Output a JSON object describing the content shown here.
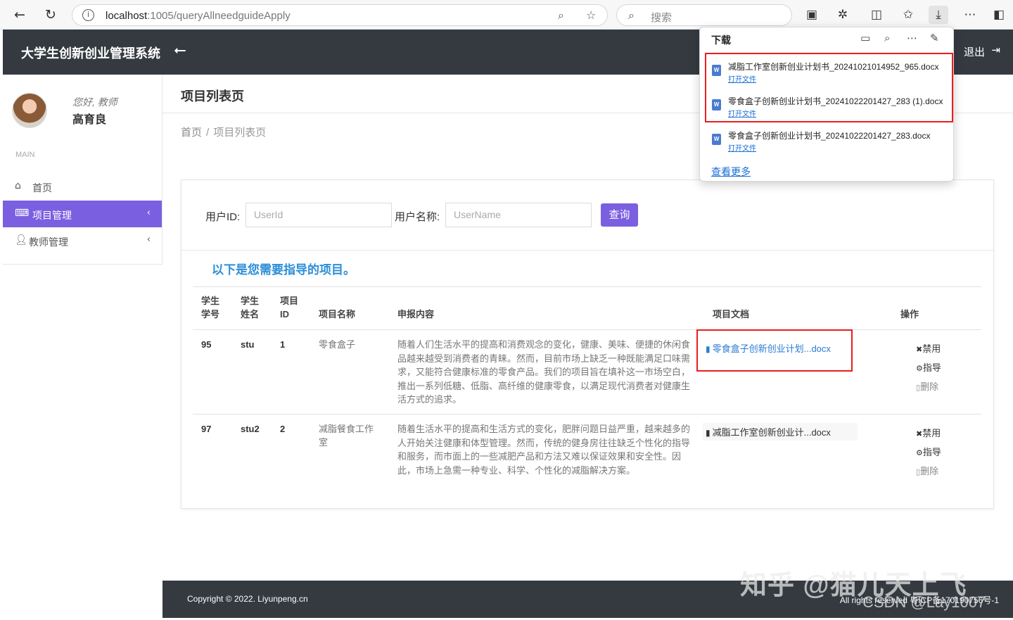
{
  "browser": {
    "url_host": "localhost",
    "url_path": ":1005/queryAllneedguideApply",
    "search_placeholder": "搜索"
  },
  "header": {
    "app_title": "大学生创新创业管理系统",
    "logout_label": "退出"
  },
  "sidebar": {
    "greeting": "您好, 教师",
    "user_name": "高育良",
    "menu_label": "MAIN",
    "items": [
      {
        "label": "首页",
        "icon": "home-icon"
      },
      {
        "label": "项目管理",
        "icon": "keyboard-icon",
        "active": true
      },
      {
        "label": "教师管理",
        "icon": "user-icon"
      }
    ]
  },
  "page": {
    "title": "项目列表页",
    "breadcrumb_home": "首页",
    "breadcrumb_sep": "/",
    "breadcrumb_current": "项目列表页"
  },
  "form": {
    "userid_label": "用户ID:",
    "userid_placeholder": "UserId",
    "username_label": "用户名称:",
    "username_placeholder": "UserName",
    "query_label": "查询"
  },
  "notice": "以下是您需要指导的项目。",
  "table": {
    "headers": {
      "stu_id_1": "学生",
      "stu_id_2": "学号",
      "stu_name_1": "学生",
      "stu_name_2": "姓名",
      "proj_id_1": "项目",
      "proj_id_2": "ID",
      "proj_name": "项目名称",
      "content": "申报内容",
      "doc": "项目文档",
      "ops": "操作"
    },
    "rows": [
      {
        "stu_id": "95",
        "stu_name": "stu",
        "proj_id": "1",
        "proj_name": "零食盒子",
        "content": "随着人们生活水平的提高和消费观念的变化，健康、美味、便捷的休闲食品越来越受到消费者的青睐。然而，目前市场上缺乏一种既能满足口味需求，又能符合健康标准的零食产品。我们的项目旨在填补这一市场空白，推出一系列低糖、低脂、高纤维的健康零食，以满足现代消费者对健康生活方式的追求。",
        "doc": "零食盒子创新创业计划...docx",
        "op_disable": "禁用",
        "op_guide": "指导",
        "op_delete": "删除"
      },
      {
        "stu_id": "97",
        "stu_name": "stu2",
        "proj_id": "2",
        "proj_name": "减脂餐食工作室",
        "content": "随着生活水平的提高和生活方式的变化，肥胖问题日益严重，越来越多的人开始关注健康和体型管理。然而，传统的健身房往往缺乏个性化的指导和服务，而市面上的一些减肥产品和方法又难以保证效果和安全性。因此，市场上急需一种专业、科学、个性化的减脂解决方案。",
        "doc": "减脂工作室创新创业计...docx",
        "op_disable": "禁用",
        "op_guide": "指导",
        "op_delete": "删除"
      }
    ]
  },
  "footer": {
    "copyright": "Copyright © 2022. Liyunpeng.cn",
    "rights": "All rights reserved 粤ICP备170190756号-1"
  },
  "watermark": {
    "main": "知乎 @猫儿天上飞",
    "sub": "CSDN @Lay1007"
  },
  "downloads": {
    "title": "下载",
    "items": [
      {
        "name": "减脂工作室创新创业计划书_20241021014952_965.docx",
        "open": "打开文件"
      },
      {
        "name": "零食盒子创新创业计划书_20241022201427_283 (1).docx",
        "open": "打开文件"
      },
      {
        "name": "零食盒子创新创业计划书_20241022201427_283.docx",
        "open": "打开文件"
      }
    ],
    "more": "查看更多"
  },
  "colors": {
    "header_bg": "#343a40",
    "accent": "#7a60e0",
    "link": "#2b7cd3",
    "highlight": "#e81e1e"
  }
}
